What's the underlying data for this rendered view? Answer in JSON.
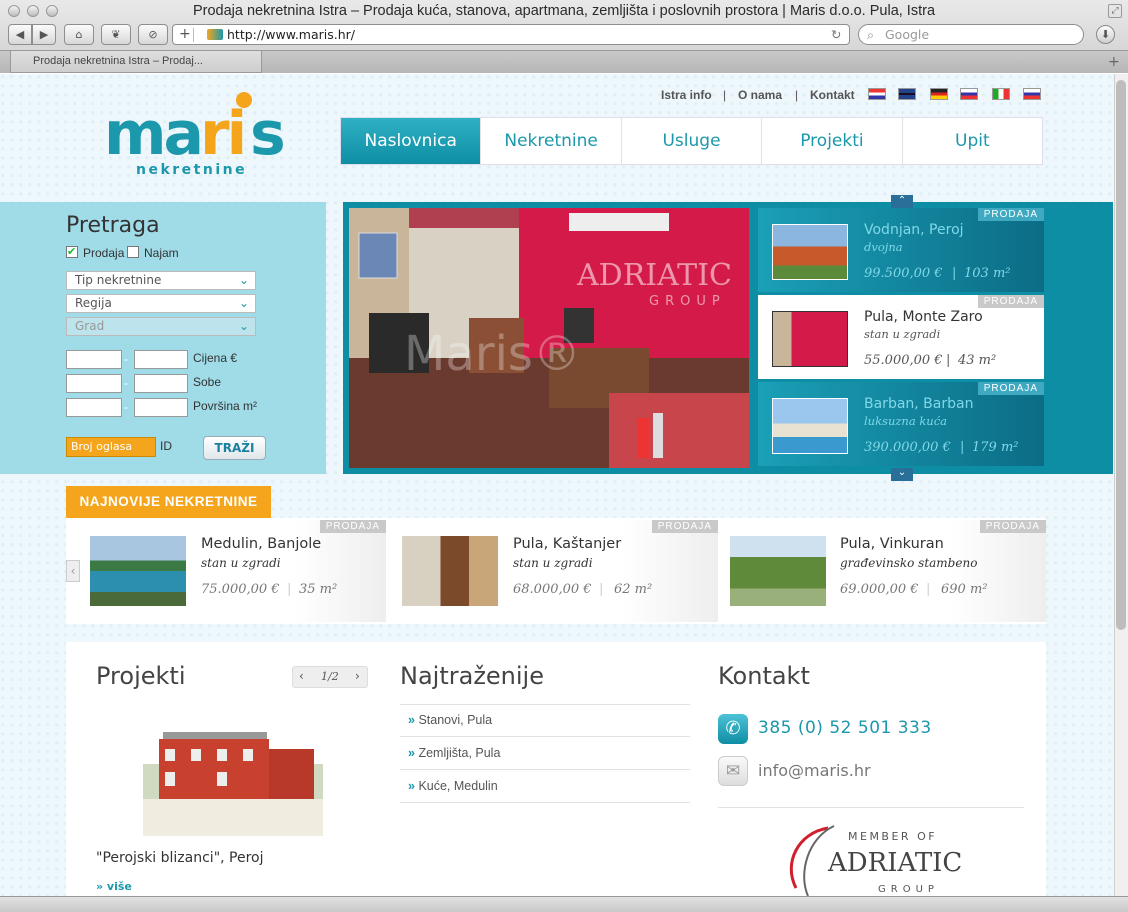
{
  "window": {
    "title": "Prodaja nekretnina Istra – Prodaja kuća, stanova, apartmana, zemljišta i poslovnih prostora | Maris d.o.o. Pula, Istra"
  },
  "toolbar": {
    "url": "http://www.maris.hr/",
    "search_placeholder": "Google",
    "new_tab": "+"
  },
  "tabs": [
    {
      "label": "Prodaja nekretnina Istra – Prodaj..."
    }
  ],
  "header": {
    "logo_text": "maris",
    "logo_sub": "nekretnine",
    "top_links": [
      "Istra info",
      "O nama",
      "Kontakt"
    ],
    "separator": "|",
    "languages": [
      "hr",
      "en",
      "de",
      "si",
      "it",
      "ru"
    ]
  },
  "nav": [
    "Naslovnica",
    "Nekretnine",
    "Usluge",
    "Projekti",
    "Upit"
  ],
  "search": {
    "title": "Pretraga",
    "cb_prodaja": "Prodaja",
    "cb_najam": "Najam",
    "type": "Tip nekretnine",
    "region": "Regija",
    "city": "Grad",
    "dash": "-",
    "ranges": [
      "Cijena €",
      "Sobe",
      "Površina m²"
    ],
    "id_placeholder": "Broj oglasa",
    "id_label": "ID",
    "button": "TRAŽI"
  },
  "slider": {
    "watermark_brand": "ADRIATIC",
    "watermark_sub": "GROUP",
    "watermark_maris": "Maris®",
    "items": [
      {
        "badge": "PRODAJA",
        "title": "Vodnjan, Peroj",
        "sub": "dvojna",
        "price": "99.500,00 €",
        "sep": "|",
        "area": "103 m²"
      },
      {
        "badge": "PRODAJA",
        "title": "Pula, Monte Zaro",
        "sub": "stan u zgradi",
        "price": "55.000,00 €",
        "sep": "|",
        "area": "43 m²"
      },
      {
        "badge": "PRODAJA",
        "title": "Barban, Barban",
        "sub": "luksuzna kuća",
        "price": "390.000,00 €",
        "sep": "|",
        "area": "179 m²"
      }
    ]
  },
  "latest": {
    "label": "NAJNOVIJE NEKRETNINE",
    "items": [
      {
        "badge": "PRODAJA",
        "title": "Medulin, Banjole",
        "sub": "stan u zgradi",
        "price": "75.000,00 €",
        "sep": "|",
        "area": "35 m²"
      },
      {
        "badge": "PRODAJA",
        "title": "Pula, Kaštanjer",
        "sub": "stan u zgradi",
        "price": "68.000,00 €",
        "sep": "|",
        "area": "62 m²"
      },
      {
        "badge": "PRODAJA",
        "title": "Pula, Vinkuran",
        "sub": "građevinsko stambeno",
        "price": "69.000,00 €",
        "sep": "|",
        "area": "690 m²"
      }
    ]
  },
  "projects": {
    "title": "Projekti",
    "pager": "1/2",
    "caption": "\"Perojski blizanci\", Peroj",
    "more": "» više"
  },
  "wanted": {
    "title": "Najtraženije",
    "bullet": "»",
    "links": [
      "Stanovi, Pula",
      "Zemljišta, Pula",
      "Kuće, Medulin"
    ]
  },
  "contact": {
    "title": "Kontakt",
    "phone": "385 (0) 52 501 333",
    "email": "info@maris.hr",
    "member_of": "MEMBER OF",
    "brand": "ADRIATIC",
    "brand_sub": "GROUP"
  },
  "colors": {
    "accent": "#1b98ab",
    "orange": "#f4a51c",
    "search_bg": "#a0dce8",
    "slider_bg": "#0e8ea4"
  }
}
